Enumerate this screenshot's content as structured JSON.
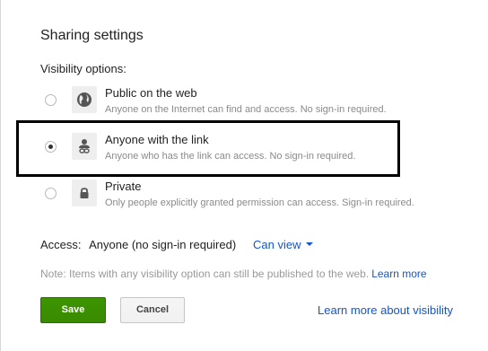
{
  "dialog": {
    "title": "Sharing settings",
    "section_label": "Visibility options:"
  },
  "options": [
    {
      "title": "Public on the web",
      "description": "Anyone on the Internet can find and access. No sign-in required.",
      "icon": "globe-icon",
      "selected": false
    },
    {
      "title": "Anyone with the link",
      "description": "Anyone who has the link can access. No sign-in required.",
      "icon": "person-link-icon",
      "selected": true
    },
    {
      "title": "Private",
      "description": "Only people explicitly granted permission can access. Sign-in required.",
      "icon": "lock-icon",
      "selected": false
    }
  ],
  "access": {
    "label": "Access:",
    "value": "Anyone (no sign-in required)",
    "permission": "Can view"
  },
  "note": {
    "text": "Note: Items with any visibility option can still be published to the web.",
    "link": "Learn more"
  },
  "buttons": {
    "save": "Save",
    "cancel": "Cancel"
  },
  "footer_link": "Learn more about visibility",
  "colors": {
    "save_green": "#3d9400",
    "link_blue": "#1155cc",
    "highlight_border": "#000000"
  }
}
